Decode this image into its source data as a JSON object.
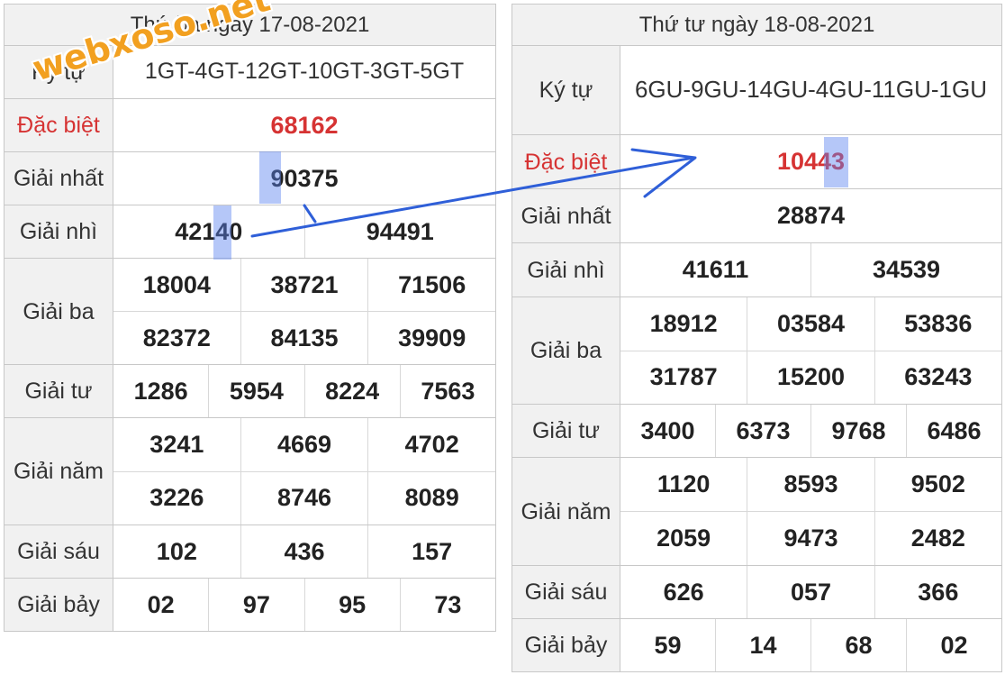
{
  "left": {
    "date_header": "Thứ ba ngày 17-08-2021",
    "code_label": "Ký tự",
    "code": "1GT-4GT-12GT-10GT-3GT-5GT",
    "rows": [
      {
        "label": "Đặc biệt",
        "values": [
          "68162"
        ]
      },
      {
        "label": "Giải nhất",
        "values": [
          "90375"
        ]
      },
      {
        "label": "Giải nhì",
        "values": [
          "42140",
          "94491"
        ]
      },
      {
        "label": "Giải ba",
        "values": [
          "18004",
          "38721",
          "71506",
          "82372",
          "84135",
          "39909"
        ]
      },
      {
        "label": "Giải tư",
        "values": [
          "1286",
          "5954",
          "8224",
          "7563"
        ]
      },
      {
        "label": "Giải năm",
        "values": [
          "3241",
          "4669",
          "4702",
          "3226",
          "8746",
          "8089"
        ]
      },
      {
        "label": "Giải sáu",
        "values": [
          "102",
          "436",
          "157"
        ]
      },
      {
        "label": "Giải bảy",
        "values": [
          "02",
          "97",
          "95",
          "73"
        ]
      }
    ]
  },
  "right": {
    "date_header": "Thứ tư ngày 18-08-2021",
    "code_label": "Ký tự",
    "code": "6GU-9GU-14GU-4GU-11GU-1GU",
    "rows": [
      {
        "label": "Đặc biệt",
        "values": [
          "10443"
        ]
      },
      {
        "label": "Giải nhất",
        "values": [
          "28874"
        ]
      },
      {
        "label": "Giải nhì",
        "values": [
          "41611",
          "34539"
        ]
      },
      {
        "label": "Giải ba",
        "values": [
          "18912",
          "03584",
          "53836",
          "31787",
          "15200",
          "63243"
        ]
      },
      {
        "label": "Giải tư",
        "values": [
          "3400",
          "6373",
          "9768",
          "6486"
        ]
      },
      {
        "label": "Giải năm",
        "values": [
          "1120",
          "8593",
          "9502",
          "2059",
          "9473",
          "2482"
        ]
      },
      {
        "label": "Giải sáu",
        "values": [
          "626",
          "057",
          "366"
        ]
      },
      {
        "label": "Giải bảy",
        "values": [
          "59",
          "14",
          "68",
          "02"
        ]
      }
    ]
  },
  "watermark": "webxoso.net",
  "colors": {
    "special_prize": "#d63333",
    "label_background": "#f1f1f1",
    "highlight": "#5a82f0",
    "arrow": "#2f5fd8",
    "watermark": "#f2a020"
  }
}
